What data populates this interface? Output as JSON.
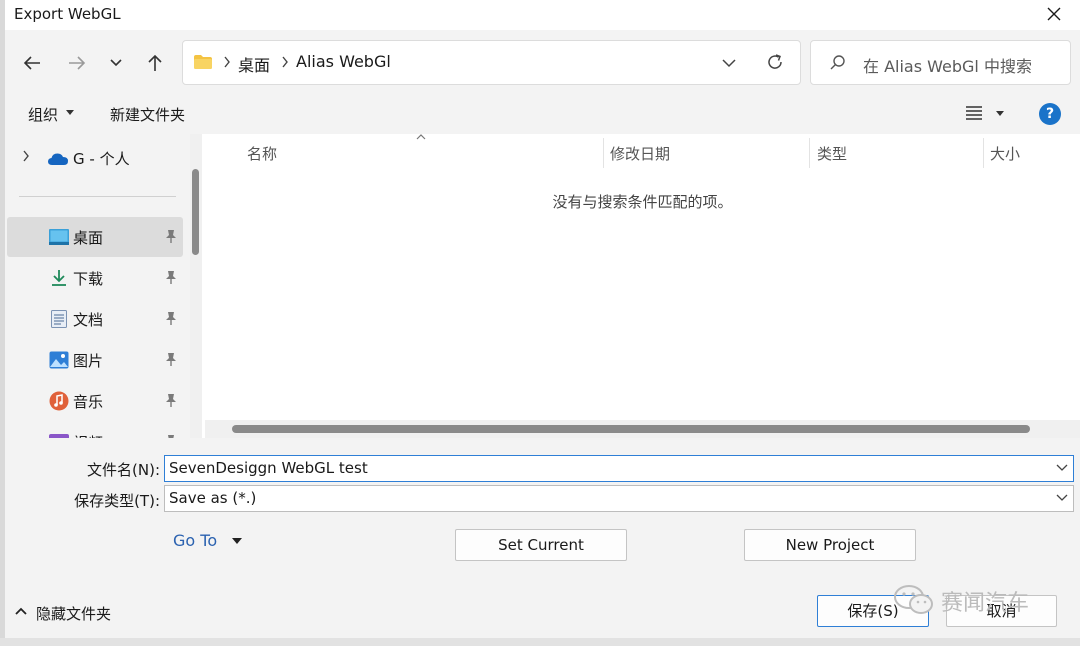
{
  "window": {
    "title": "Export WebGL"
  },
  "address": {
    "crumbs": [
      "桌面",
      "Alias WebGl"
    ]
  },
  "search": {
    "placeholder": "在 Alias WebGl 中搜索"
  },
  "toolbar": {
    "organize": "组织",
    "new_folder": "新建文件夹"
  },
  "sidebar": {
    "onedrive": "G - 个人",
    "items": [
      {
        "label": "桌面",
        "icon": "desktop-icon",
        "selected": true
      },
      {
        "label": "下载",
        "icon": "download-icon"
      },
      {
        "label": "文档",
        "icon": "document-icon"
      },
      {
        "label": "图片",
        "icon": "picture-icon"
      },
      {
        "label": "音乐",
        "icon": "music-icon"
      },
      {
        "label": "视频",
        "icon": "video-icon"
      }
    ]
  },
  "columns": [
    "名称",
    "修改日期",
    "类型",
    "大小"
  ],
  "empty_message": "没有与搜索条件匹配的项。",
  "form": {
    "filename_label": "文件名(N):",
    "filename_value": "SevenDesiggn WebGL test",
    "filetype_label": "保存类型(T):",
    "filetype_value": "Save as (*.)"
  },
  "actions": {
    "goto": "Go To",
    "set_current": "Set Current",
    "new_project": "New Project",
    "save": "保存(S)",
    "cancel": "取消",
    "hide_folders": "隐藏文件夹"
  },
  "watermark": "赛闻汽车",
  "colors": {
    "accent": "#1a73c9",
    "link": "#2b62b0",
    "focus": "#2f7fd6"
  }
}
